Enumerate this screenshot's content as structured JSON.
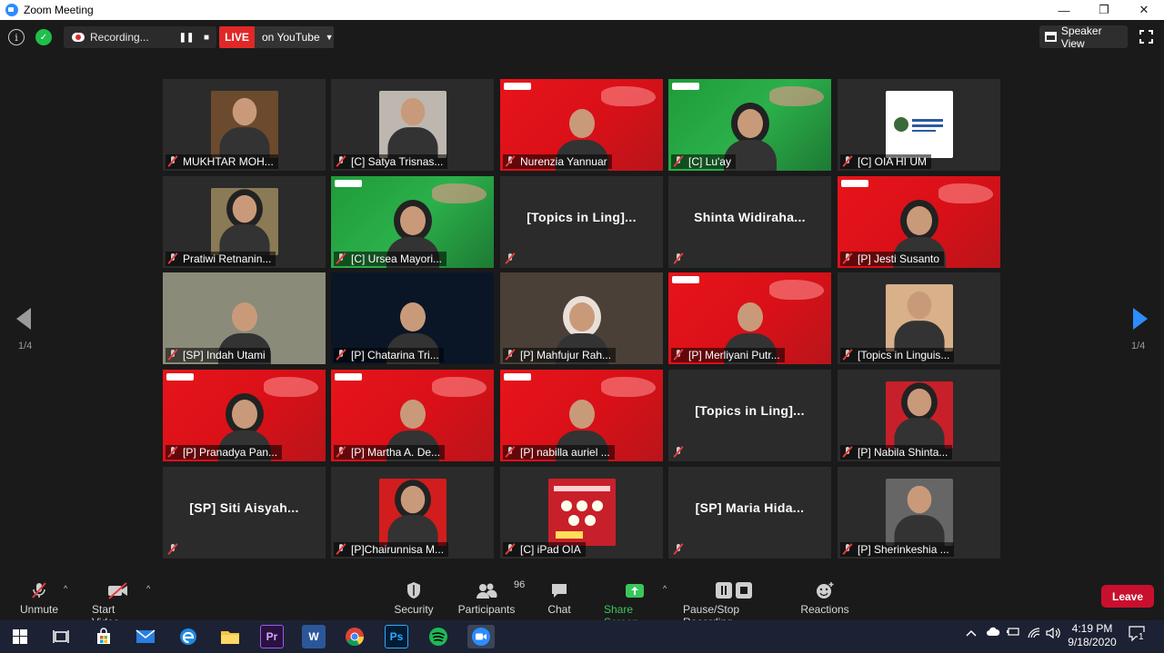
{
  "window": {
    "title": "Zoom Meeting",
    "minimize": "—",
    "restore": "❐",
    "close": "✕"
  },
  "topbar": {
    "recording_label": "Recording...",
    "pause_glyph": "❚❚",
    "stop_glyph": "■",
    "live_label": "LIVE",
    "stream_target": "on YouTube",
    "view_mode": "Speaker View"
  },
  "gallery": {
    "page_left": "1/4",
    "page_right": "1/4",
    "tiles": [
      {
        "name": "MUKHTAR MOH...",
        "kind": "photo",
        "bg": "#6b4a2e"
      },
      {
        "name": "[C] Satya Trisnas...",
        "kind": "photo",
        "bg": "#bdb7b0"
      },
      {
        "name": "Nurenzia Yannuar",
        "kind": "video",
        "bg": "red",
        "active": true
      },
      {
        "name": "[C] Lu'ay",
        "kind": "video",
        "bg": "green"
      },
      {
        "name": "[C] OIA HI UM",
        "kind": "logo",
        "bg": "#ffffff"
      },
      {
        "name": "Pratiwi Retnanin...",
        "kind": "photo",
        "bg": "#8a7a55"
      },
      {
        "name": "[C] Ursea Mayori...",
        "kind": "video",
        "bg": "green"
      },
      {
        "name": "[Topics in Ling]...",
        "kind": "name"
      },
      {
        "name": "Shinta Widiraha...",
        "kind": "name"
      },
      {
        "name": "[P] Jesti Susanto",
        "kind": "video",
        "bg": "red"
      },
      {
        "name": "[SP] Indah Utami",
        "kind": "video",
        "bg": "#8b8b7a"
      },
      {
        "name": "[P] Chatarina Tri...",
        "kind": "video",
        "bg": "#0a1626"
      },
      {
        "name": "[P] Mahfujur Rah...",
        "kind": "video",
        "bg": "#4a4038"
      },
      {
        "name": "[P] Merliyani Putr...",
        "kind": "video",
        "bg": "red"
      },
      {
        "name": "[Topics in Linguis...",
        "kind": "photo",
        "bg": "#d8b08a"
      },
      {
        "name": "[P] Pranadya Pan...",
        "kind": "video",
        "bg": "red"
      },
      {
        "name": "[P] Martha A. De...",
        "kind": "video",
        "bg": "red"
      },
      {
        "name": "[P] nabilla auriel ...",
        "kind": "video",
        "bg": "red"
      },
      {
        "name": "[Topics in Ling]...",
        "kind": "name"
      },
      {
        "name": "[P] Nabila Shinta...",
        "kind": "photo",
        "bg": "#c8202a"
      },
      {
        "name": "[SP] Siti Aisyah...",
        "kind": "name"
      },
      {
        "name": "[P]Chairunnisa M...",
        "kind": "photo",
        "bg": "#d11d1d"
      },
      {
        "name": "[C] iPad OIA",
        "kind": "poster",
        "bg": "#c8202a"
      },
      {
        "name": "[SP] Maria Hida...",
        "kind": "name"
      },
      {
        "name": "[P] Sherinkeshia ...",
        "kind": "photo",
        "bg": "#666666"
      }
    ]
  },
  "toolbar": {
    "unmute": "Unmute",
    "start_video": "Start Video",
    "security": "Security",
    "participants": "Participants",
    "participant_count": "96",
    "chat": "Chat",
    "share_screen": "Share Screen",
    "pause_stop_recording": "Pause/Stop Recording",
    "reactions": "Reactions",
    "leave": "Leave",
    "caret": "^"
  },
  "taskbar": {
    "time": "4:19 PM",
    "date": "9/18/2020",
    "notification_count": "1",
    "apps": [
      "start-icon",
      "task-view-icon",
      "store-icon",
      "mail-icon",
      "edge-icon",
      "file-explorer-icon",
      "premiere-icon",
      "word-icon",
      "chrome-icon",
      "photoshop-icon",
      "spotify-icon",
      "zoom-icon"
    ]
  },
  "colors": {
    "accent_blue": "#2d8cff",
    "live_red": "#e02828",
    "share_green": "#3ac75a",
    "leave_red": "#c8102e",
    "active_speaker": "#e8e84f"
  }
}
